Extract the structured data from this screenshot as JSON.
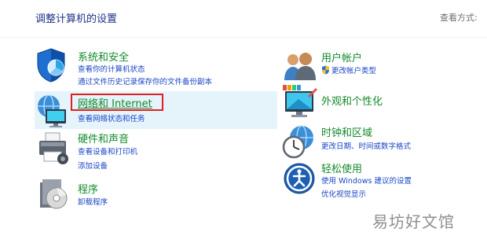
{
  "header": {
    "title": "调整计算机的设置",
    "view_by": "查看方式:"
  },
  "categories": {
    "system_security": {
      "title": "系统和安全",
      "links": [
        "查看你的计算机状态",
        "通过文件历史记录保存你的文件备份副本"
      ]
    },
    "network": {
      "title": "网络和 Internet",
      "links": [
        "查看网络状态和任务"
      ]
    },
    "hardware": {
      "title": "硬件和声音",
      "links": [
        "查看设备和打印机",
        "添加设备"
      ]
    },
    "programs": {
      "title": "程序",
      "links": [
        "卸载程序"
      ]
    },
    "user_accounts": {
      "title": "用户帐户",
      "links": [
        "更改帐户类型"
      ]
    },
    "appearance": {
      "title": "外观和个性化",
      "links": []
    },
    "clock_region": {
      "title": "时钟和区域",
      "links": [
        "更改日期、时间或数字格式"
      ]
    },
    "ease_access": {
      "title": "轻松使用",
      "links": [
        "使用 Windows 建议的设置",
        "优化视觉显示"
      ]
    }
  },
  "watermark": "易坊好文馆",
  "colors": {
    "title_green": "#148a2b",
    "link_blue": "#1a47c7",
    "highlight_bg": "#e5f3fb",
    "annotation_red": "#e02020"
  }
}
